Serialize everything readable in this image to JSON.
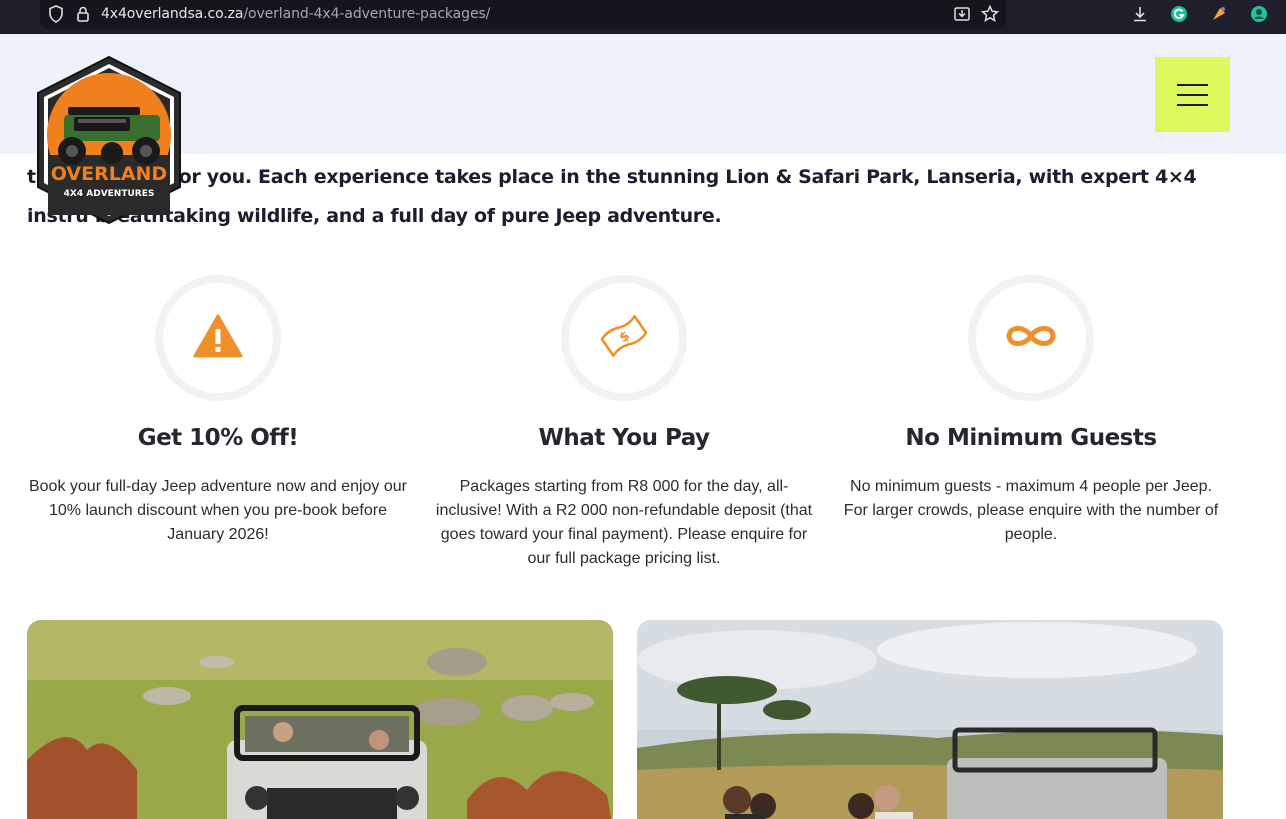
{
  "browser": {
    "url_domain": "4x4overlandsa.co.za",
    "url_path": "/overland-4x4-adventure-packages/"
  },
  "logo": {
    "name": "OVERLAND",
    "tagline": "4X4 ADVENTURES"
  },
  "intro": {
    "text": "t                age waiting for you.   Each experience takes place in the stunning Lion & Safari Park, Lanseria, with expert 4×4 instru          breathtaking wildlife, and a full day of pure Jeep adventure."
  },
  "features": [
    {
      "icon": "warning-icon",
      "title": "Get 10% Off!",
      "text": "Book your full-day Jeep adventure now and enjoy our 10% launch discount when you pre-book before January 2026!"
    },
    {
      "icon": "money-icon",
      "title": "What You Pay",
      "text": "Packages starting from R8 000 for the day, all-inclusive! With a R2 000 non-refundable deposit (that goes toward your final payment). Please enquire for our full package pricing list."
    },
    {
      "icon": "infinity-icon",
      "title": "No Minimum Guests",
      "text": "No minimum guests - maximum 4 people per Jeep. For larger crowds, please enquire with the number of people."
    }
  ],
  "colors": {
    "accent_orange": "#f0902a",
    "menu_button": "#d9f95c",
    "header_bg": "#f0f2fb"
  }
}
